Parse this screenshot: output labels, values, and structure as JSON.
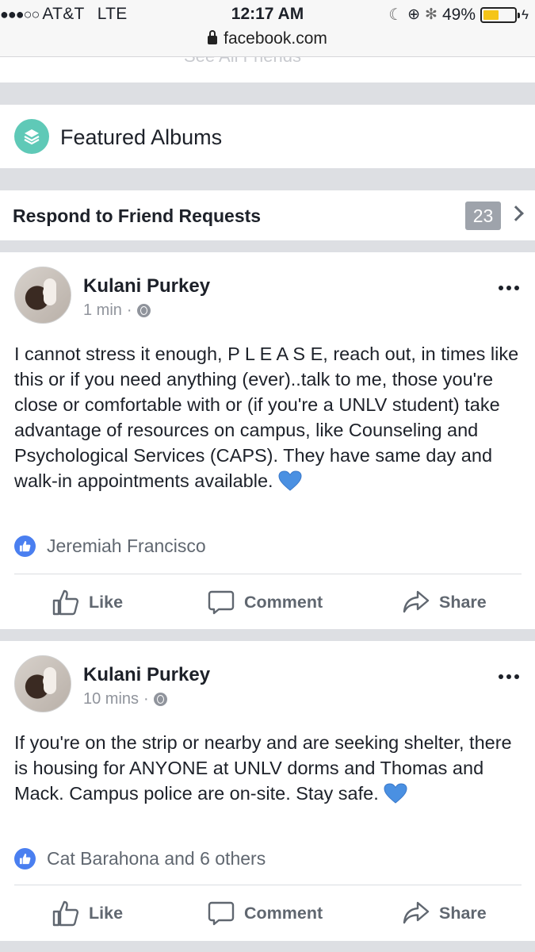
{
  "status_bar": {
    "signal": "●●●○○",
    "carrier": "AT&T",
    "network": "LTE",
    "time": "12:17 AM",
    "battery_pct": "49%",
    "battery_level": 0.49,
    "url": "facebook.com"
  },
  "partial_section": {
    "label": "See All Friends"
  },
  "featured": {
    "label": "Featured Albums",
    "icon": "layers-icon",
    "icon_color": "#5fc9b7"
  },
  "friend_requests": {
    "label": "Respond to Friend Requests",
    "count": "23"
  },
  "posts": [
    {
      "author": "Kulani Purkey",
      "time": "1 min",
      "separator": "·",
      "text": "I cannot stress it enough, P L E A S E, reach out, in times like this or if you need anything (ever)..talk to me, those you're close or comfortable with or (if you're a UNLV student) take advantage of resources on campus, like Counseling and Psychological Services (CAPS). They have same day and walk-in appointments available.",
      "reactions": "Jeremiah Francisco",
      "actions": {
        "like": "Like",
        "comment": "Comment",
        "share": "Share"
      }
    },
    {
      "author": "Kulani Purkey",
      "time": "10 mins",
      "separator": "·",
      "text": "If you're on the strip or nearby and are seeking shelter, there is housing for ANYONE at UNLV dorms and Thomas and Mack. Campus police are on-site. Stay safe.",
      "reactions": "Cat Barahona and 6 others",
      "actions": {
        "like": "Like",
        "comment": "Comment",
        "share": "Share"
      }
    }
  ],
  "colors": {
    "like_blue": "#4a7ff0",
    "heart_blue": "#4a90e2",
    "badge_gray": "#9ea3ab"
  }
}
